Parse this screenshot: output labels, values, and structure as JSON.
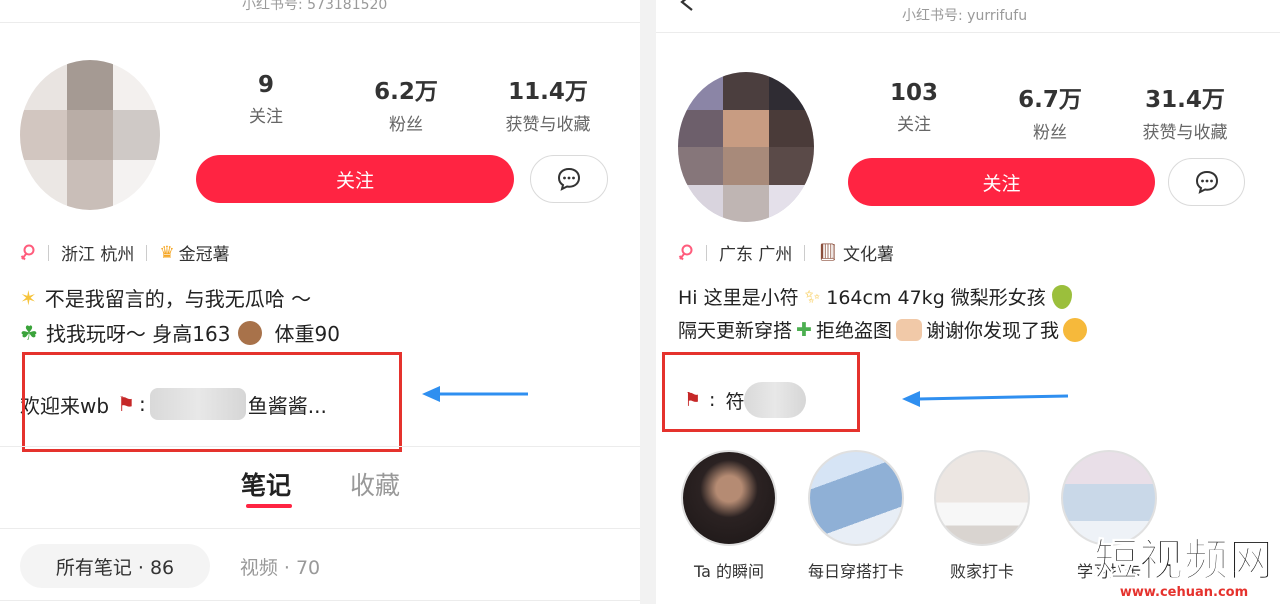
{
  "left": {
    "account_id": "小红书号: 573181520",
    "stats": [
      {
        "num": "9",
        "label": "关注"
      },
      {
        "num": "6.2万",
        "label": "粉丝"
      },
      {
        "num": "11.4万",
        "label": "获赞与收藏"
      }
    ],
    "follow_label": "关注",
    "location": "浙江  杭州",
    "badge": "金冠薯",
    "bio_line1": "不是我留言的，与我无瓜哈 ～",
    "bio_line2_a": "找我玩呀～ 身高163",
    "bio_line2_b": "体重90",
    "wb_prefix": "欢迎来wb",
    "wb_colon": ":",
    "wb_suffix": "鱼酱酱...",
    "tabs": [
      "笔记",
      "收藏"
    ],
    "filters": [
      "所有笔记 · 86",
      "视频 · 70"
    ]
  },
  "right": {
    "account_id": "小红书号: yurrifufu",
    "stats": [
      {
        "num": "103",
        "label": "关注"
      },
      {
        "num": "6.7万",
        "label": "粉丝"
      },
      {
        "num": "31.4万",
        "label": "获赞与收藏"
      }
    ],
    "follow_label": "关注",
    "location": "广东  广州",
    "badge": "文化薯",
    "bio_line1_a": "Hi 这里是小符",
    "bio_line1_b": "164cm 47kg 微梨形女孩",
    "bio_line2_a": "隔天更新穿搭",
    "bio_line2_b": "拒绝盗图",
    "bio_line2_c": "谢谢你发现了我",
    "wb_colon": ":",
    "wb_name": "符",
    "highlights": [
      "Ta 的瞬间",
      "每日穿搭打卡",
      "败家打卡",
      "学习打卡"
    ]
  },
  "watermark": {
    "cn": "短视频网",
    "url": "www.cehuan.com"
  },
  "colors": {
    "brand_red": "#ff2442",
    "annotation_red": "#e5322d",
    "arrow_blue": "#2f8ff0"
  }
}
